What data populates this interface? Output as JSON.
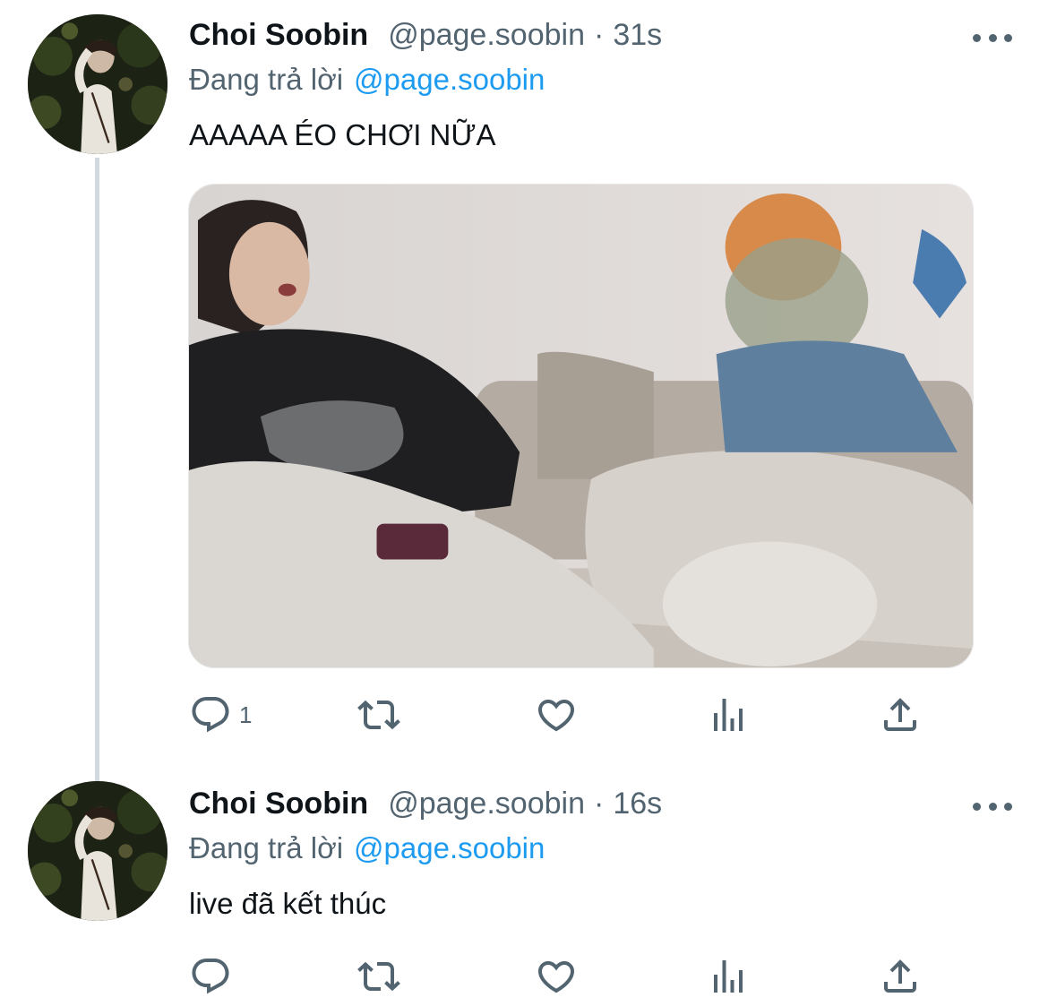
{
  "colors": {
    "text_primary": "#0f1419",
    "text_secondary": "#536471",
    "mention": "#1d9bf0",
    "thread_line": "#cfd9de",
    "icon": "#536471"
  },
  "tweets": [
    {
      "display_name": "Choi Soobin",
      "handle": "@page.soobin",
      "separator": "·",
      "time": "31s",
      "reply_prefix": "Đang trả lời",
      "reply_mention": "@page.soobin",
      "text": "AAAAA ÉO CHƠI NỮA",
      "has_media": true,
      "actions": {
        "reply_count": "1",
        "icons": [
          "reply-icon",
          "retweet-icon",
          "like-icon",
          "views-icon",
          "share-icon"
        ]
      }
    },
    {
      "display_name": "Choi Soobin",
      "handle": "@page.soobin",
      "separator": "·",
      "time": "16s",
      "reply_prefix": "Đang trả lời",
      "reply_mention": "@page.soobin",
      "text": "live đã kết thúc",
      "has_media": false,
      "actions": {
        "reply_count": "",
        "icons": [
          "reply-icon",
          "retweet-icon",
          "like-icon",
          "views-icon",
          "share-icon"
        ]
      }
    }
  ]
}
